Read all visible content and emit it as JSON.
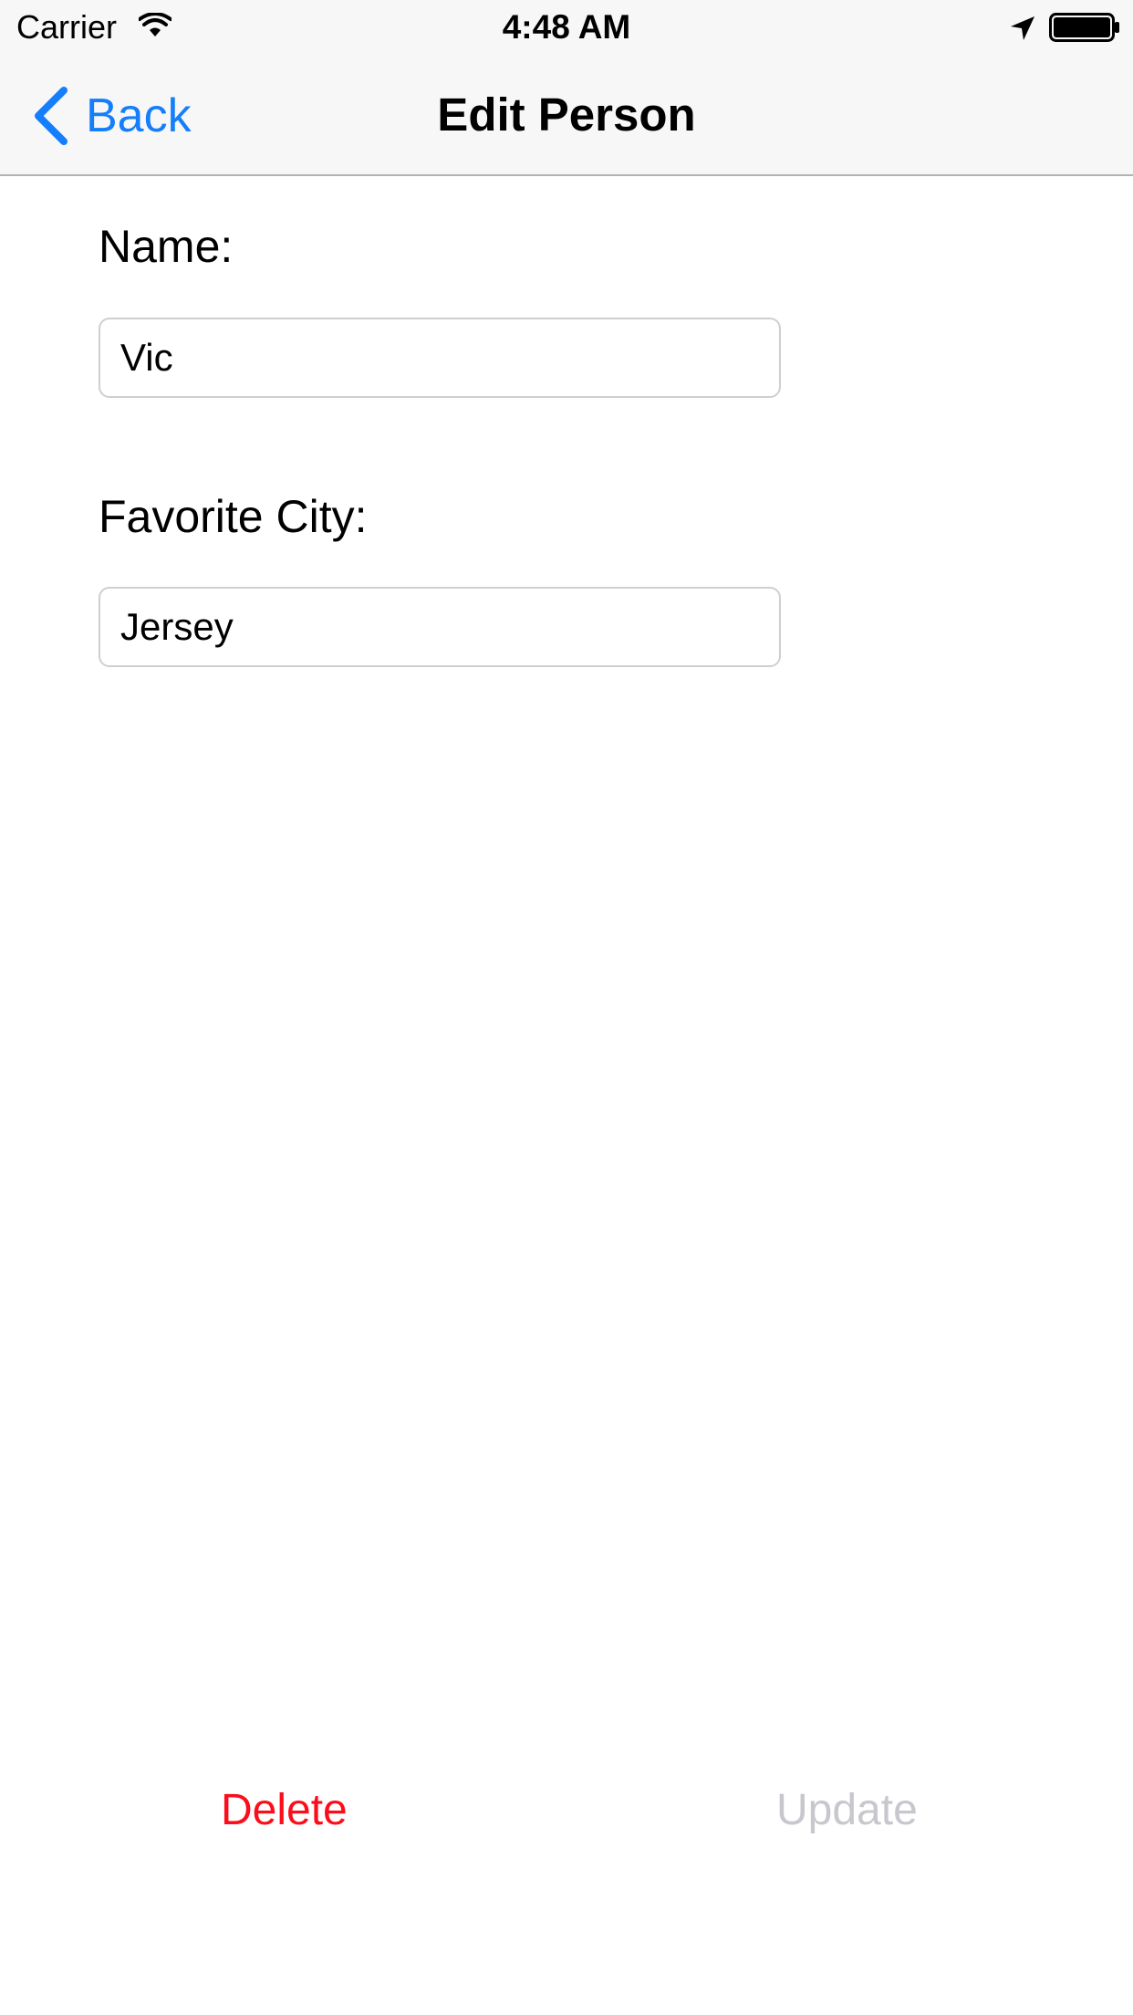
{
  "status_bar": {
    "carrier": "Carrier",
    "time": "4:48 AM",
    "icons": [
      "wifi-icon",
      "location-arrow-icon",
      "battery-icon"
    ]
  },
  "nav_bar": {
    "back_label": "Back",
    "title": "Edit Person"
  },
  "form": {
    "name_label": "Name:",
    "name_value": "Vic",
    "city_label": "Favorite City:",
    "city_value": "Jersey"
  },
  "actions": {
    "delete_label": "Delete",
    "update_label": "Update"
  },
  "colors": {
    "tint": "#147efb",
    "destructive": "#fc0d1b",
    "disabled": "#c7c7cd",
    "bar_background": "#f7f7f7"
  }
}
